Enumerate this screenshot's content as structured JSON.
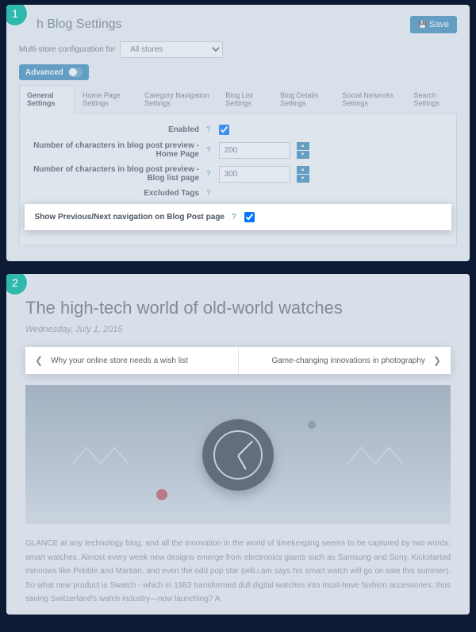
{
  "panel1": {
    "badge": "1",
    "title": "h Blog Settings",
    "save": "Save",
    "multi_label": "Multi-store configuration for",
    "multi_option": "All stores",
    "advanced": "Advanced",
    "tabs": {
      "general": "General Settings",
      "home": "Home Page Settings",
      "category": "Category Navigation Settings",
      "list": "Blog List Settings",
      "details": "Blog Details Settings",
      "social": "Social Networks Settings",
      "search": "Search Settings"
    },
    "fields": {
      "enabled": "Enabled",
      "chars_home": "Number of characters in blog post preview - Home Page",
      "chars_home_val": "200",
      "chars_list": "Number of characters in blog post preview - Blog list page",
      "chars_list_val": "300",
      "excluded": "Excluded Tags",
      "nav": "Show Previous/Next navigation on Blog Post page"
    }
  },
  "panel2": {
    "badge": "2",
    "title": "The high-tech world of old-world watches",
    "date": "Wednesday, July 1, 2015",
    "prev": "Why your online store needs a wish list",
    "next": "Game-changing innovations in photography",
    "body": "GLANCE at any technology blog, and all the innovation in the world of timekeeping seems to be captured by two words: smart watches. Almost every week new designs emerge from electronics giants such as Samsung and Sony, Kickstarted minnows like Pebble and Martian, and even the odd pop star (will.i.am says his smart watch will go on sale this summer). So what new product is Swatch - which in 1983 transformed dull digital watches into must-have fashion accessories, thus saving Switzerland's watch industry—now launching? A"
  }
}
